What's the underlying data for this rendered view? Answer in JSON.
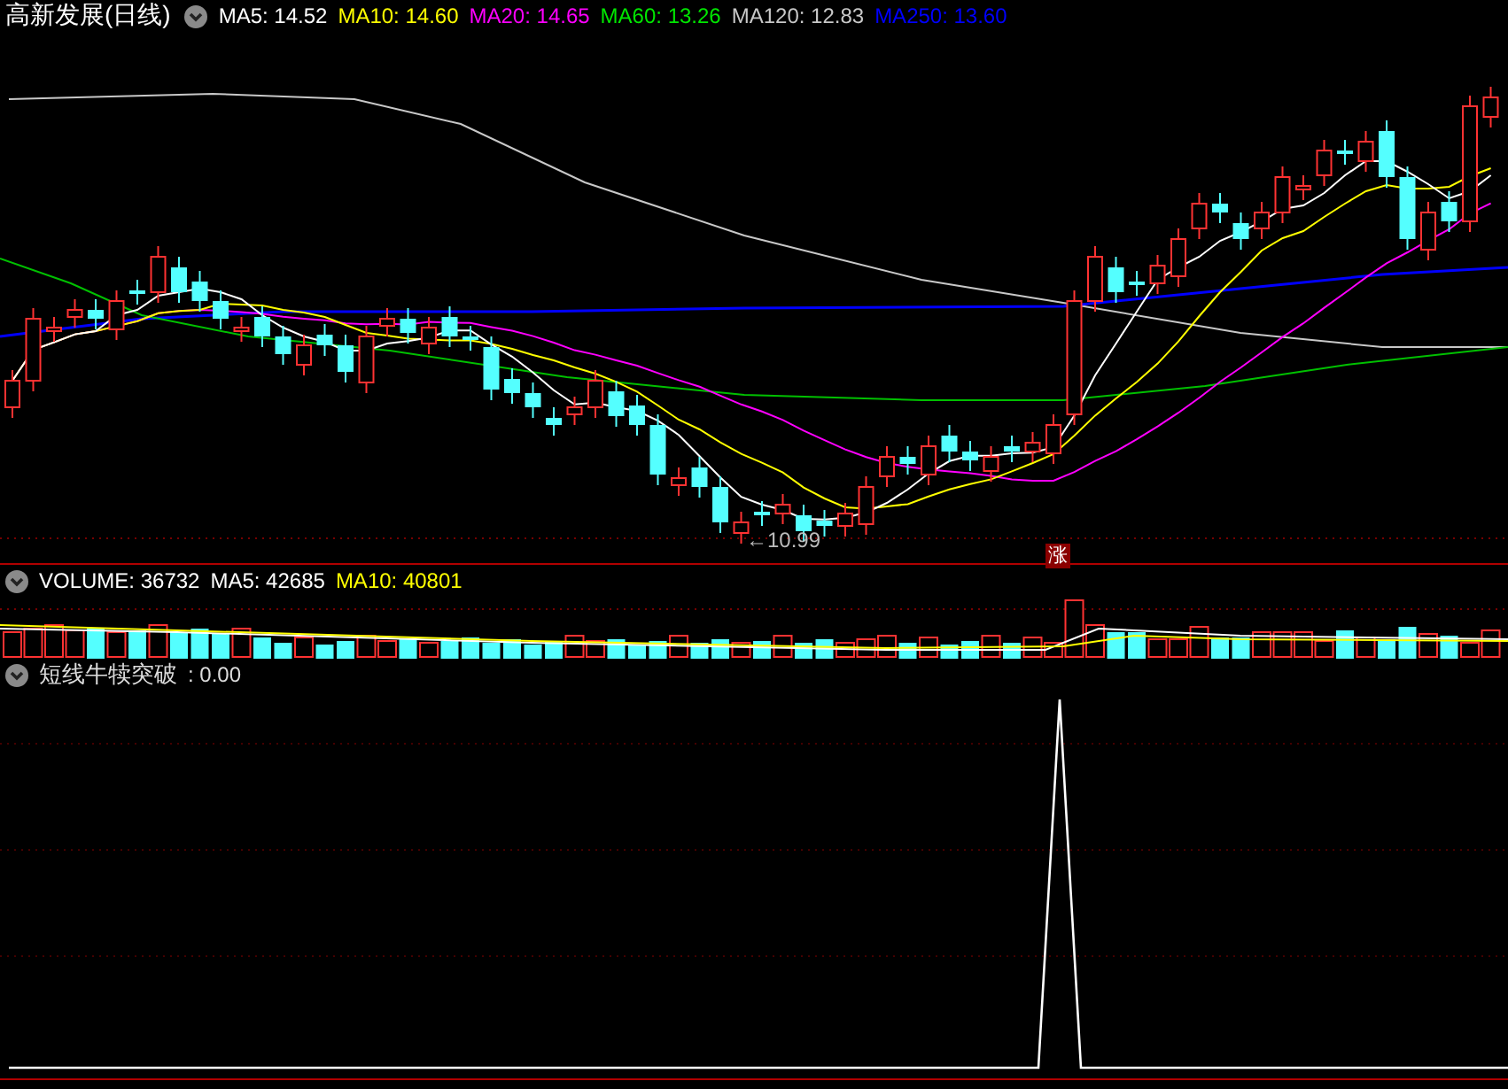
{
  "title": "高新发展(日线)",
  "ma_legend": [
    {
      "label": "MA5: 14.52",
      "color": "#ffffff"
    },
    {
      "label": "MA10: 14.60",
      "color": "#ffff00"
    },
    {
      "label": "MA20: 14.65",
      "color": "#ff00ff"
    },
    {
      "label": "MA60: 13.26",
      "color": "#00e600"
    },
    {
      "label": "MA120: 12.83",
      "color": "#c8c8c8"
    },
    {
      "label": "MA250: 13.60",
      "color": "#0000ff"
    }
  ],
  "price_chart": {
    "low_label": "←10.99",
    "badge": "涨"
  },
  "volume_legend": [
    {
      "label": "VOLUME: 36732",
      "color": "#ffffff"
    },
    {
      "label": "MA5: 42685",
      "color": "#ffffff"
    },
    {
      "label": "MA10: 40801",
      "color": "#ffff00"
    }
  ],
  "indicator": {
    "title": "短线牛犊突破",
    "value": ": 0.00"
  }
}
